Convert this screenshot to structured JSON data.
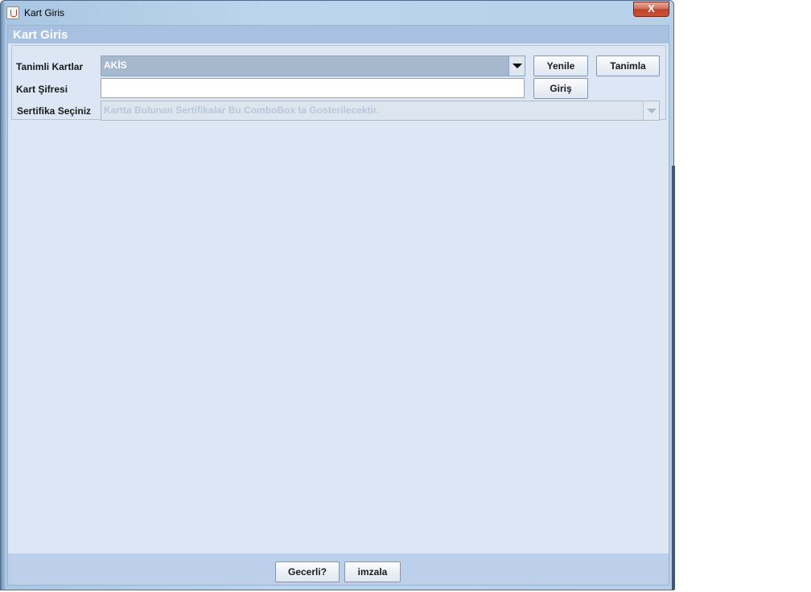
{
  "window": {
    "title": "Kart Giris",
    "close_label": "X"
  },
  "panel": {
    "title": "Kart Giris"
  },
  "form": {
    "cards_label": "Tanimli Kartlar",
    "cards_selected": "AKİS",
    "password_label": "Kart Şifresi",
    "password_value": "",
    "certificate_label": "Sertifika Seçiniz",
    "certificate_placeholder": "Kartta Bulunan Sertifikalar Bu ComboBox ta Gosterilecektir."
  },
  "buttons": {
    "refresh": "Yenile",
    "define": "Tanimla",
    "login": "Giriş",
    "valid": "Gecerli?",
    "sign": "imzala"
  },
  "colors": {
    "panel_header": "#a9c1e1",
    "client_bg": "#dce6f5",
    "footer_bg": "#bccfeb",
    "close_button": "#c9543a"
  },
  "icons": {
    "app": "java-cup-icon",
    "close": "close-icon",
    "dropdown": "chevron-down-icon"
  }
}
